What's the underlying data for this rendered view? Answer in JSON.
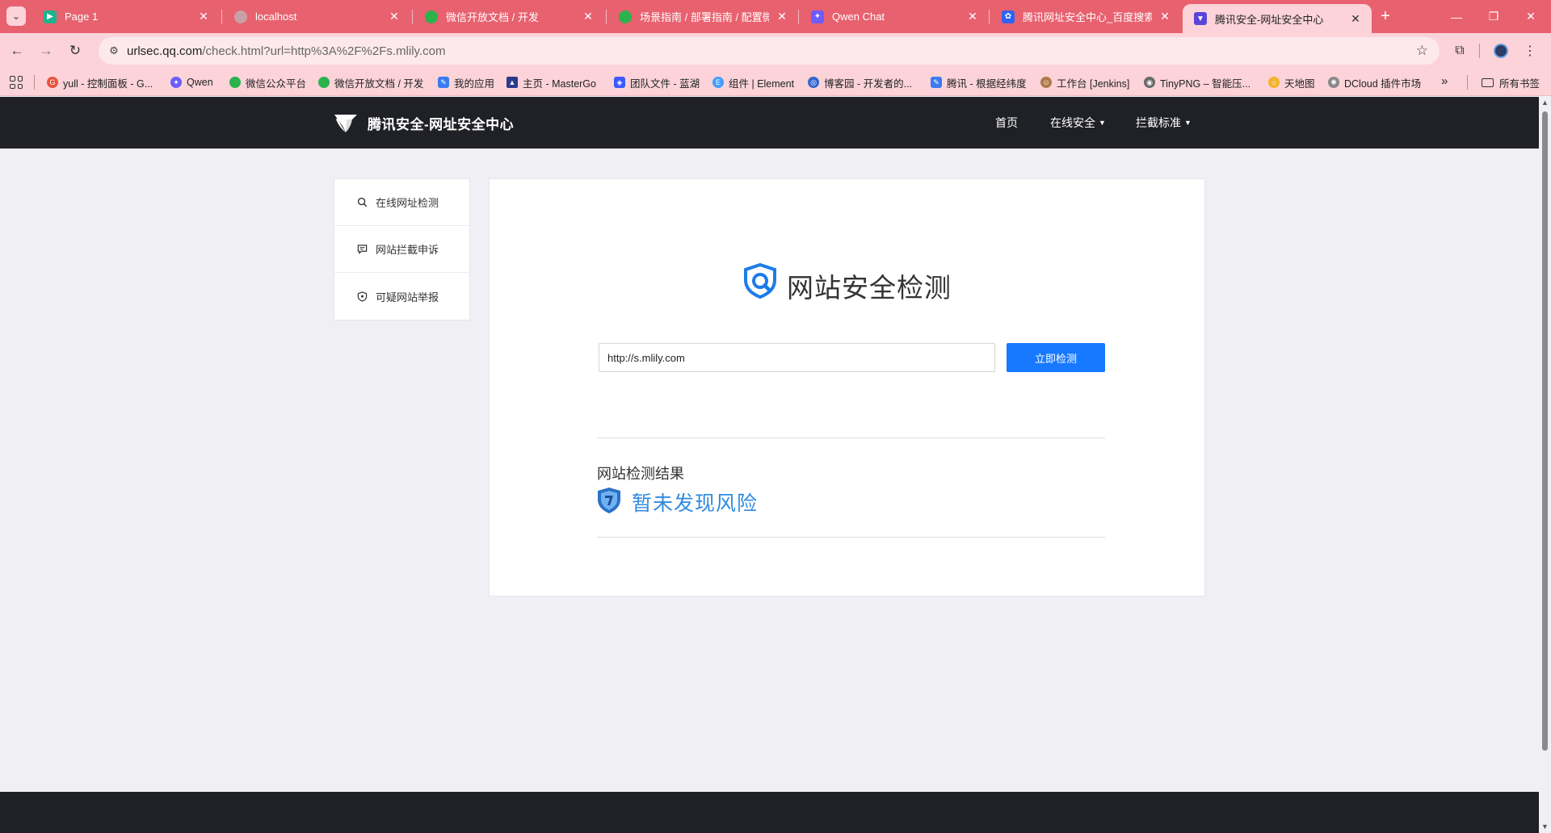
{
  "browser": {
    "tabs": [
      {
        "label": "Page 1",
        "favicon_color": "#1bb38c"
      },
      {
        "label": "localhost",
        "favicon_color": "#c9a0a8"
      },
      {
        "label": "微信开放文档 / 开发",
        "favicon_color": "#2bb24c"
      },
      {
        "label": "场景指南 / 部署指南 / 配置微信",
        "favicon_color": "#2bb24c"
      },
      {
        "label": "Qwen Chat",
        "favicon_color": "#6b5cff"
      },
      {
        "label": "腾讯网址安全中心_百度搜索",
        "favicon_color": "#3063f2"
      },
      {
        "label": "腾讯安全-网址安全中心",
        "favicon_color": "#5a45d8",
        "active": true
      }
    ],
    "url_host": "urlsec.qq.com",
    "url_rest": "/check.html?url=http%3A%2F%2Fs.mlily.com",
    "bookmarks": [
      {
        "label": "yull - 控制面板 - G...",
        "color": "#e8543f"
      },
      {
        "label": "Qwen",
        "color": "#6b5cff"
      },
      {
        "label": "微信公众平台",
        "color": "#2bb24c"
      },
      {
        "label": "微信开放文档 / 开发",
        "color": "#2bb24c"
      },
      {
        "label": "我的应用",
        "color": "#3a7bf0"
      },
      {
        "label": "主页 - MasterGo",
        "color": "#2d3a8c"
      },
      {
        "label": "团队文件 - 蓝湖",
        "color": "#3d5afe"
      },
      {
        "label": "组件 | Element",
        "color": "#409eff"
      },
      {
        "label": "博客园 - 开发者的...",
        "color": "#3366cc"
      },
      {
        "label": "腾讯 - 根据经纬度",
        "color": "#3a7bf0"
      },
      {
        "label": "工作台 [Jenkins]",
        "color": "#b07a4a"
      },
      {
        "label": "TinyPNG – 智能压...",
        "color": "#6a6a6a"
      },
      {
        "label": "天地图",
        "color": "#f2b330"
      },
      {
        "label": "DCloud 插件市场",
        "color": "#888888"
      }
    ],
    "bookmarks_all": "所有书签"
  },
  "site": {
    "title": "腾讯安全-网址安全中心",
    "nav": [
      {
        "label": "首页",
        "dropdown": false
      },
      {
        "label": "在线安全",
        "dropdown": true
      },
      {
        "label": "拦截标准",
        "dropdown": true
      }
    ],
    "sidebar": [
      {
        "label": "在线网址检测",
        "icon": "search-icon"
      },
      {
        "label": "网站拦截申诉",
        "icon": "comment-icon"
      },
      {
        "label": "可疑网站举报",
        "icon": "shield-icon"
      }
    ],
    "main": {
      "heading": "网站安全检测",
      "input_value": "http://s.mlily.com",
      "button_label": "立即检测",
      "result_label": "网站检测结果",
      "result_text": "暂未发现风险"
    },
    "accent_color": "#1779ff",
    "header_color": "#202126"
  }
}
